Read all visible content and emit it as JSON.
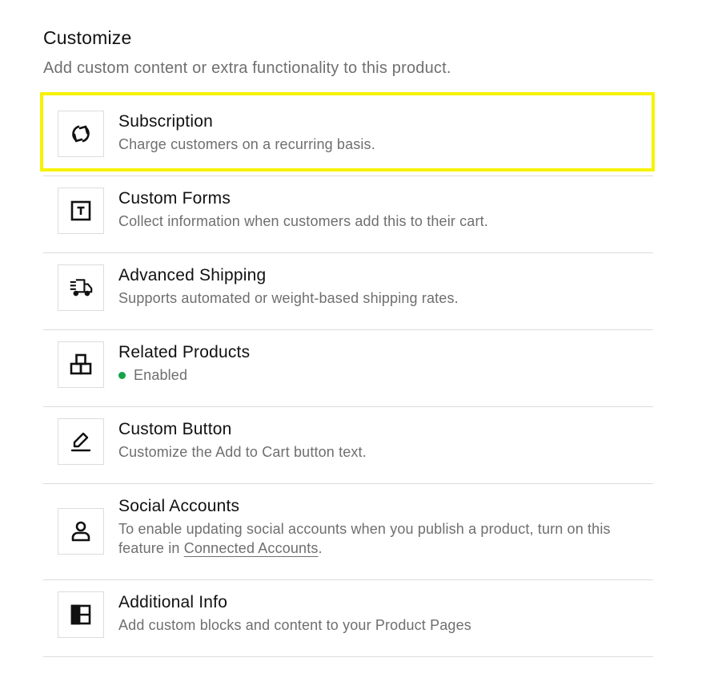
{
  "header": {
    "title": "Customize",
    "subtitle": "Add custom content or extra functionality to this product."
  },
  "items": [
    {
      "icon": "refresh-icon",
      "name": "Subscription",
      "desc": "Charge customers on a recurring basis.",
      "highlighted": true
    },
    {
      "icon": "form-icon",
      "name": "Custom Forms",
      "desc": "Collect information when customers add this to their cart."
    },
    {
      "icon": "truck-icon",
      "name": "Advanced Shipping",
      "desc": "Supports automated or weight-based shipping rates."
    },
    {
      "icon": "blocks-icon",
      "name": "Related Products",
      "status": "Enabled",
      "status_color": "#16a34a"
    },
    {
      "icon": "pencil-icon",
      "name": "Custom Button",
      "desc": "Customize the Add to Cart button text."
    },
    {
      "icon": "user-icon",
      "name": "Social Accounts",
      "desc_prefix": "To enable updating social accounts when you publish a product, turn on this feature in ",
      "desc_link": "Connected Accounts",
      "desc_suffix": "."
    },
    {
      "icon": "layout-icon",
      "name": "Additional Info",
      "desc": "Add custom blocks and content to your Product Pages"
    }
  ],
  "colors": {
    "highlight": "#f7f200",
    "border": "#dcdcdc",
    "muted_text": "#6f6f6f"
  }
}
